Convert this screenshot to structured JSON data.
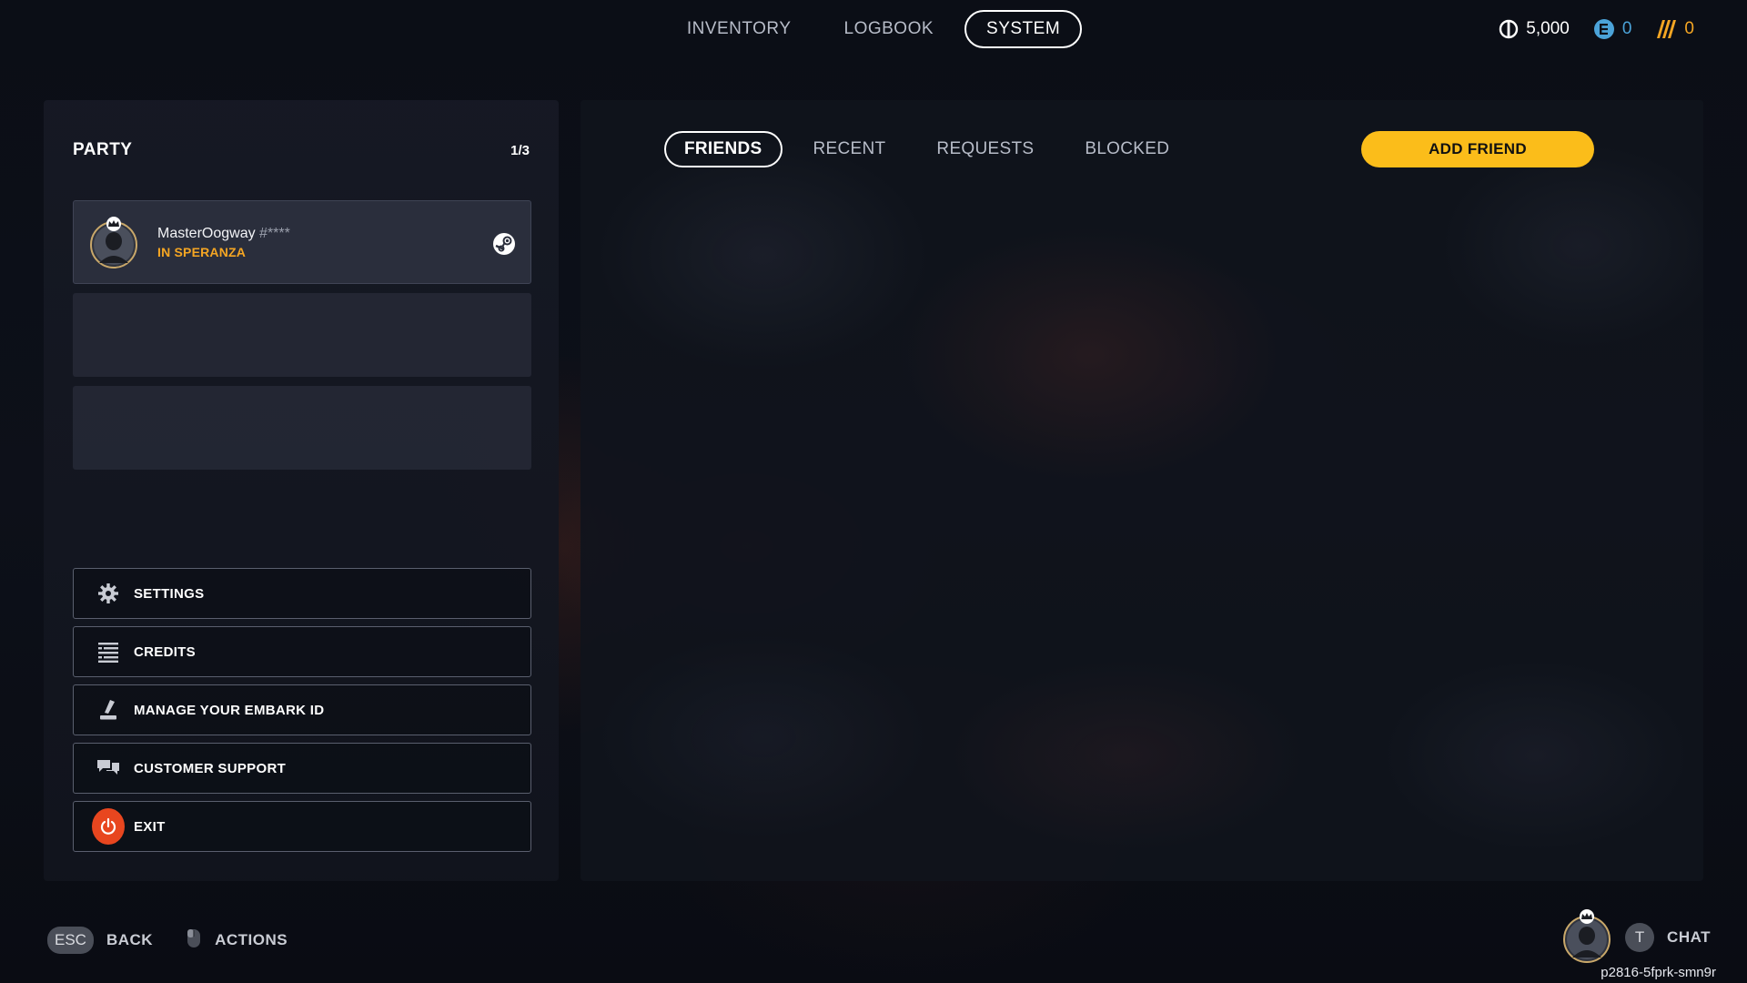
{
  "top_nav": {
    "tabs": [
      {
        "label": "INVENTORY",
        "active": false
      },
      {
        "label": "LOGBOOK",
        "active": false
      },
      {
        "label": "SYSTEM",
        "active": true
      }
    ]
  },
  "currencies": {
    "coins": {
      "value": "5,000",
      "icon": "coins-icon"
    },
    "tickets": {
      "value": "0",
      "icon": "ticket-icon"
    },
    "multibucks": {
      "value": "0",
      "icon": "multibucks-icon"
    }
  },
  "party": {
    "title": "PARTY",
    "count": "1/3",
    "members": [
      {
        "name": "MasterOogway",
        "tag": "#****",
        "status": "IN SPERANZA",
        "platform": "steam-icon"
      }
    ]
  },
  "menu": {
    "items": [
      {
        "label": "SETTINGS",
        "icon": "gear-icon"
      },
      {
        "label": "CREDITS",
        "icon": "list-icon"
      },
      {
        "label": "MANAGE YOUR EMBARK ID",
        "icon": "embark-id-icon"
      },
      {
        "label": "CUSTOMER SUPPORT",
        "icon": "chat-bubbles-icon"
      },
      {
        "label": "EXIT",
        "icon": "power-icon"
      }
    ]
  },
  "friends": {
    "tabs": [
      {
        "label": "FRIENDS",
        "active": true
      },
      {
        "label": "RECENT",
        "active": false
      },
      {
        "label": "REQUESTS",
        "active": false
      },
      {
        "label": "BLOCKED",
        "active": false
      }
    ],
    "add_friend_label": "ADD FRIEND"
  },
  "bottom": {
    "esc_key": "ESC",
    "back_label": "BACK",
    "actions_label": "ACTIONS",
    "chat_key": "T",
    "chat_label": "CHAT",
    "player_id": "p2816-5fprk-smn9r"
  },
  "colors": {
    "accent_yellow": "#fbbd1a",
    "status_orange": "#f5a623",
    "exit_red": "#e8461f",
    "ticket_blue": "#4ba3d9"
  }
}
